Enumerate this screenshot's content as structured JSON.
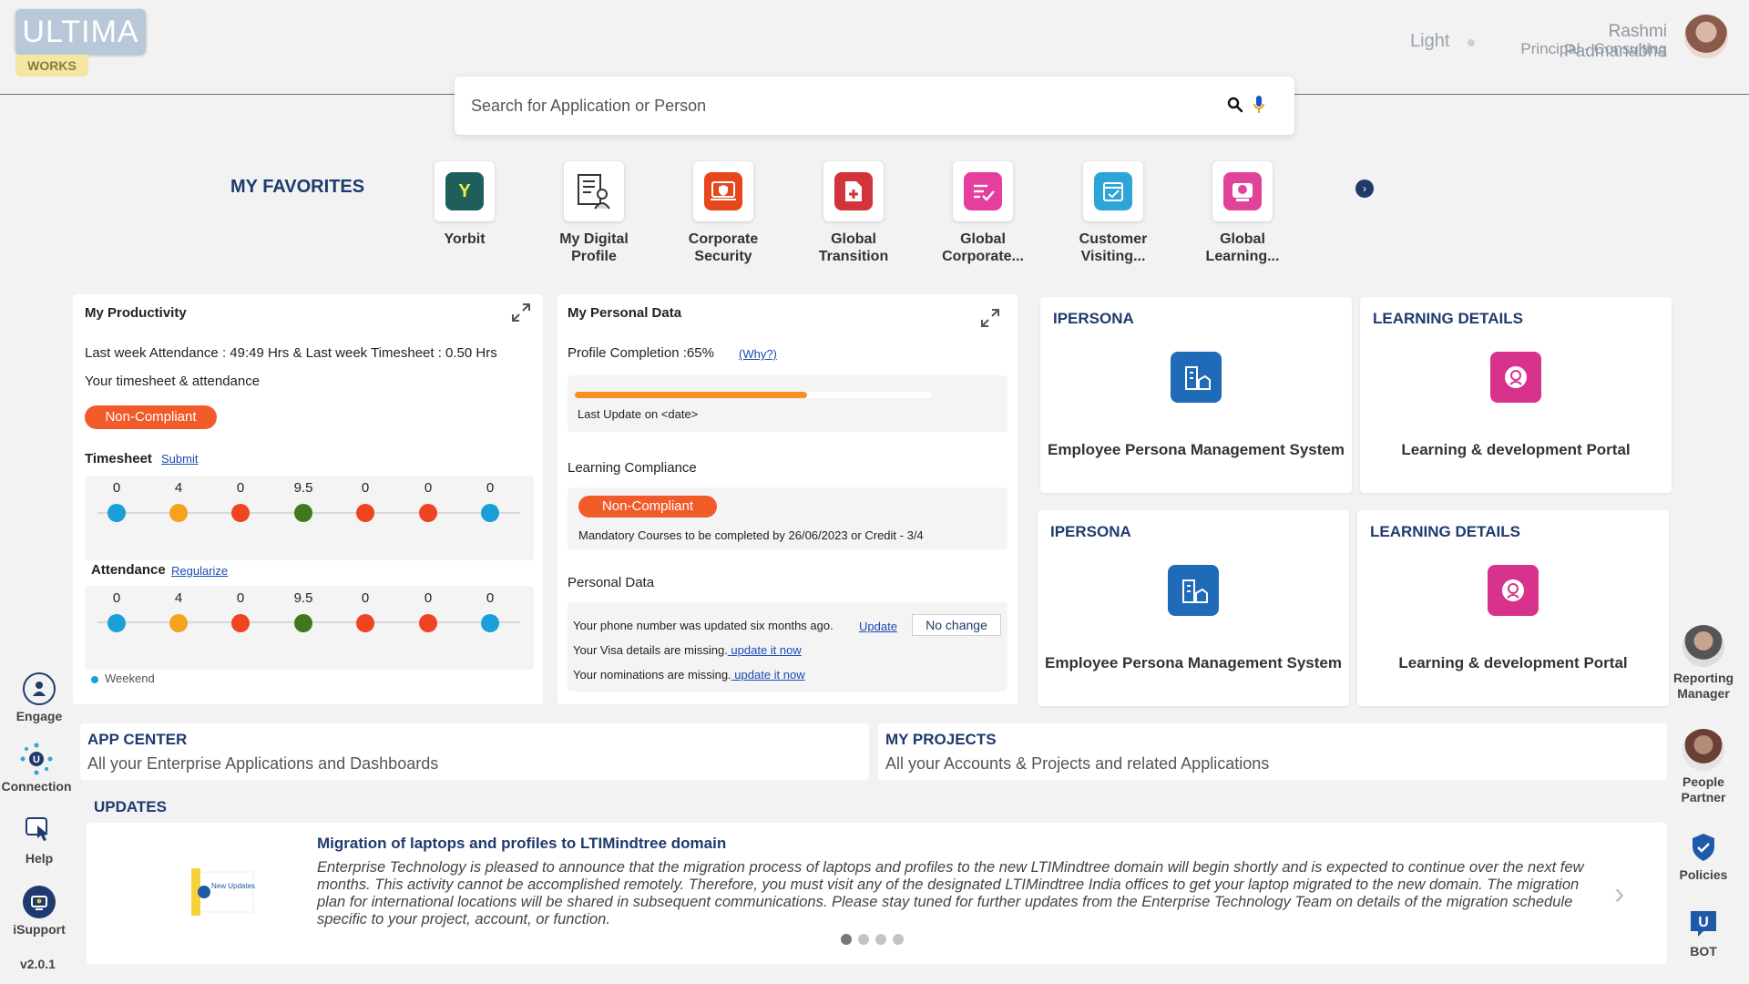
{
  "header": {
    "logo_text": "ULTIMA",
    "logo_sub": "WORKS",
    "theme_label": "Light",
    "user_name": "Rashmi Padmanabha",
    "user_title": "Principal - Consulting"
  },
  "search": {
    "placeholder": "Search for Application or Person"
  },
  "favorites": {
    "title": "MY FAVORITES",
    "items": [
      {
        "label": "Yorbit",
        "icon": "yorbit-icon",
        "color": "#1f5e5a"
      },
      {
        "label": "My Digital Profile",
        "icon": "digital-profile-icon",
        "color": "#ffffff"
      },
      {
        "label": "Corporate Security",
        "icon": "security-icon",
        "color": "#e8461c"
      },
      {
        "label": "Global Transition",
        "icon": "transition-icon",
        "color": "#d1343a"
      },
      {
        "label": "Global Corporate...",
        "icon": "corporate-icon",
        "color": "#e63e9e"
      },
      {
        "label": "Customer Visiting...",
        "icon": "customer-visit-icon",
        "color": "#2fa4d6"
      },
      {
        "label": "Global Learning...",
        "icon": "learning-icon",
        "color": "#e0449a"
      }
    ]
  },
  "productivity": {
    "title": "My Productivity",
    "attendance_line": "Last week Attendance : 49:49 Hrs & Last week Timesheet : 0.50 Hrs",
    "sub_line": "Your timesheet & attendance",
    "status": "Non-Compliant",
    "timesheet_label": "Timesheet",
    "timesheet_link": "Submit",
    "timesheet_values": [
      "0",
      "4",
      "0",
      "9.5",
      "0",
      "0",
      "0"
    ],
    "attendance_label": "Attendance",
    "attendance_link": "Regularize",
    "attendance_values": [
      "0",
      "4",
      "0",
      "9.5",
      "0",
      "0",
      "0"
    ],
    "legend": "Weekend"
  },
  "personal": {
    "title": "My Personal Data",
    "profile_completion": "Profile Completion :65%",
    "why_link": "(Why?)",
    "progress_pct": 65,
    "last_update": "Last Update on <date>",
    "learning_title": "Learning Compliance",
    "learning_status": "Non-Compliant",
    "mandatory": "Mandatory Courses to be completed by  26/06/2023 or Credit -  3/4",
    "pdata_title": "Personal Data",
    "phone_msg": "Your phone number was updated six months ago.",
    "phone_update": "Update",
    "no_change": "No change",
    "visa_msg": "Your Visa details are missing.",
    "visa_link": " update it now",
    "nom_msg": "Your nominations are missing.",
    "nom_link": " update it now"
  },
  "cards": [
    {
      "title": "IPERSONA",
      "desc": "Employee Persona Management System"
    },
    {
      "title": "LEARNING DETAILS",
      "desc": "Learning & development Portal"
    },
    {
      "title": "IPERSONA",
      "desc": "Employee Persona Management System"
    },
    {
      "title": "LEARNING DETAILS",
      "desc": "Learning & development Portal"
    }
  ],
  "left_nav": [
    {
      "label": "Engage"
    },
    {
      "label": "Connection"
    },
    {
      "label": "Help"
    },
    {
      "label": "iSupport"
    }
  ],
  "version": "v2.0.1",
  "right_nav": [
    {
      "label": "Reporting Manager"
    },
    {
      "label": "People Partner"
    },
    {
      "label": "Policies"
    },
    {
      "label": "BOT"
    }
  ],
  "app_center": {
    "title": "APP CENTER",
    "subtitle": "All your Enterprise Applications and Dashboards"
  },
  "projects": {
    "title": "MY PROJECTS",
    "subtitle": "All your Accounts & Projects and related Applications"
  },
  "updates": {
    "title": "UPDATES",
    "image_text": "New Updates",
    "headline": "Migration of laptops and profiles to LTIMindtree domain",
    "body": "Enterprise Technology is pleased to announce that the migration process of laptops and profiles to the new LTIMindtree domain will begin shortly and is expected to continue over the next few months. This activity cannot be accomplished remotely. Therefore, you must visit any of the designated LTIMindtree India offices to get your laptop migrated to the new domain. The migration plan for international locations will be shared in subsequent communications. Please stay tuned for further updates from the Enterprise Technology Team on details of the migration schedule specific to your project, account, or function."
  }
}
